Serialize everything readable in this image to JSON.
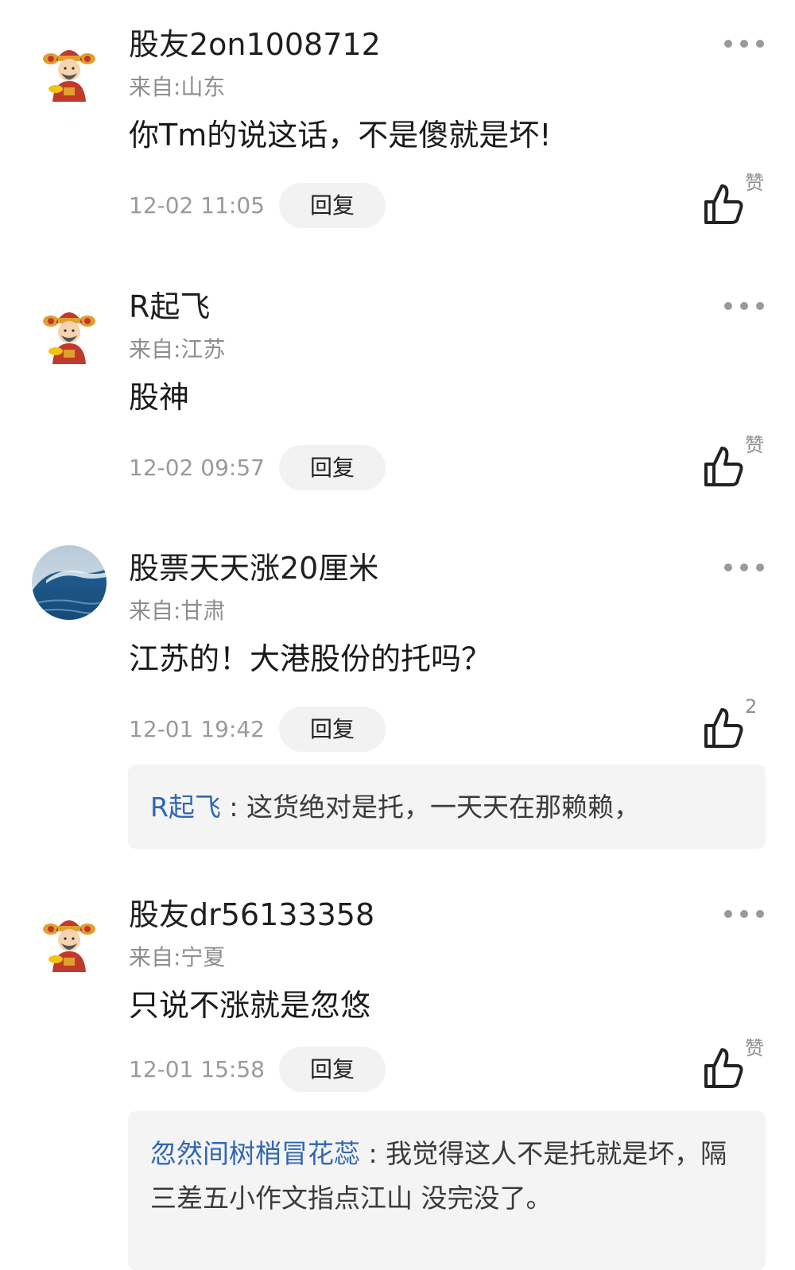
{
  "comments": [
    {
      "username": "股友2on1008712",
      "avatar": "caishen-avatar-icon",
      "location": "来自:山东",
      "content": "你Tm的说这话，不是傻就是坏!",
      "time": "12-02 11:05",
      "reply_label": "回复",
      "like_label": "赞"
    },
    {
      "username": "R起飞",
      "avatar": "caishen-avatar-icon",
      "location": "来自:江苏",
      "content": "股神",
      "time": "12-02 09:57",
      "reply_label": "回复",
      "like_label": "赞"
    },
    {
      "username": "股票天天涨20厘米",
      "avatar": "ocean-wave-avatar",
      "location": "来自:甘肃",
      "content": "江苏的！大港股份的托吗？",
      "time": "12-01 19:42",
      "reply_label": "回复",
      "like_label": "2",
      "replies": [
        {
          "user": "R起飞",
          "separator": " : ",
          "text": "这货绝对是托，一天天在那赖赖，"
        }
      ]
    },
    {
      "username": "股友dr56133358",
      "avatar": "caishen-avatar-icon",
      "location": "来自:宁夏",
      "content": "只说不涨就是忽悠",
      "time": "12-01 15:58",
      "reply_label": "回复",
      "like_label": "赞",
      "replies": [
        {
          "user": "忽然间树梢冒花蕊",
          "separator": " : ",
          "text": "我觉得这人不是托就是坏，隔三差五小作文指点江山 没完没了。"
        }
      ]
    }
  ],
  "colors": {
    "link": "#2f66b3",
    "muted": "#8e8e8e",
    "reply_bg": "#f2f2f2",
    "sub_reply_bg": "#f4f4f4"
  }
}
